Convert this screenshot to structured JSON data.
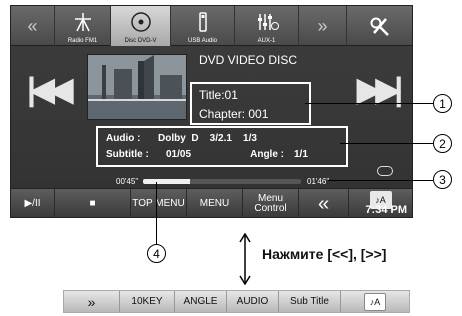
{
  "top_tabs": [
    {
      "label": "",
      "icon": "double-chevron-left-icon"
    },
    {
      "label": "Radio FM1",
      "icon": "antenna-icon"
    },
    {
      "label": "Disc DVD-V",
      "icon": "disc-icon",
      "selected": true
    },
    {
      "label": "USB Audio",
      "icon": "usb-icon"
    },
    {
      "label": "AUX-1",
      "icon": "equalizer-icon"
    },
    {
      "label": "",
      "icon": "double-chevron-right-icon"
    },
    {
      "label": "",
      "icon": "setup-tools-icon"
    }
  ],
  "disc_title": "DVD VIDEO DISC",
  "title_line": "Title:01",
  "chapter_line": "Chapter: 001",
  "audio": {
    "label": "Audio :",
    "value": "Dolby  D    3/2.1    1/3"
  },
  "subtitle": {
    "label": "Subtitle :",
    "value": "01/05"
  },
  "angle": {
    "label": "Angle :",
    "value": "1/1"
  },
  "elapsed": "00'45\"",
  "remaining": "01'46\"",
  "progress_fraction": 0.3,
  "bottom_buttons": [
    {
      "label": "▶/II",
      "name": "play-pause-button"
    },
    {
      "label": "■",
      "name": "stop-button"
    },
    {
      "label": "TOP MENU",
      "name": "top-menu-button"
    },
    {
      "label": "MENU",
      "name": "menu-button"
    },
    {
      "label": "Menu Control",
      "name": "menu-control-button"
    },
    {
      "label": "«",
      "name": "page-back-button"
    }
  ],
  "clock": "7:34 PM",
  "callouts": [
    "1",
    "2",
    "3",
    "4"
  ],
  "press_text": "Нажмите [<<], [>>]",
  "bar2_buttons": [
    "»",
    "10KEY",
    "ANGLE",
    "AUDIO",
    "Sub Title"
  ],
  "colors": {
    "screen_bg": "#343434",
    "highlight_tab": "#c8c8c8",
    "border": "#ffffff"
  }
}
